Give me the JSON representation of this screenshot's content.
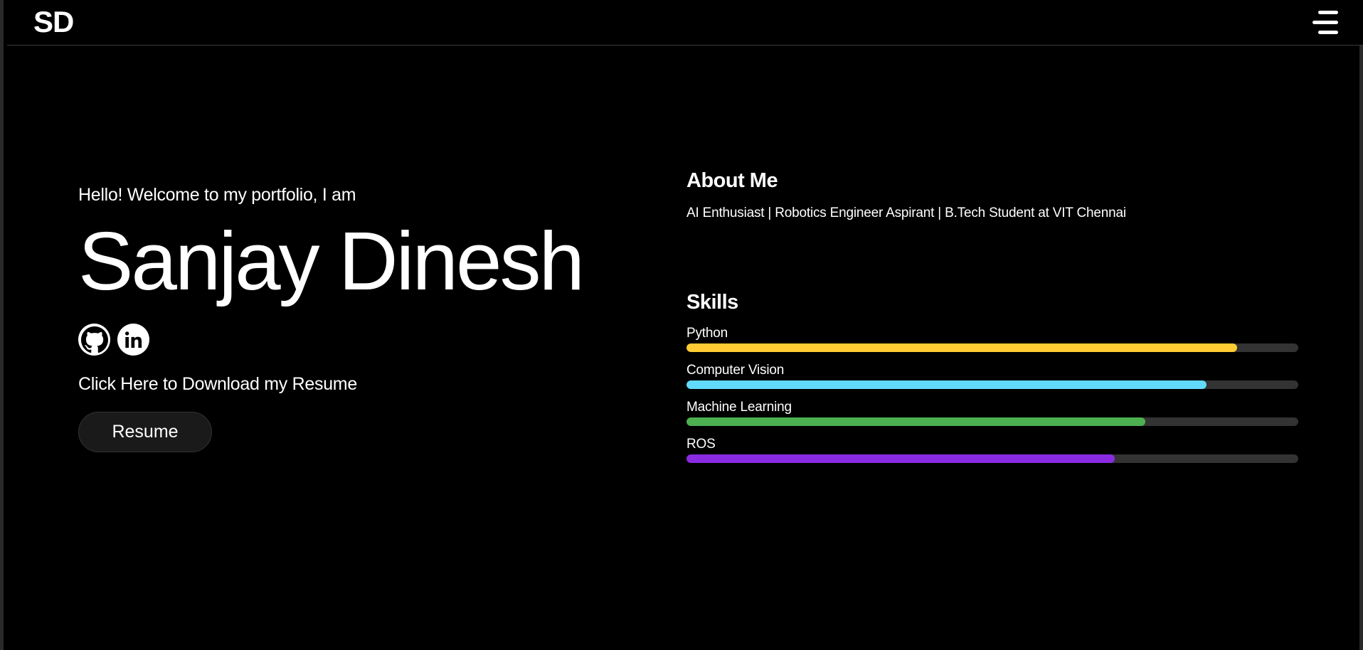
{
  "header": {
    "logo": "SD",
    "menu_icon": "hamburger-menu-icon"
  },
  "hero": {
    "greeting": "Hello! Welcome to my portfolio, I am",
    "name": "Sanjay Dinesh",
    "socials": [
      {
        "icon": "github-icon"
      },
      {
        "icon": "linkedin-icon"
      }
    ],
    "resume_prompt": "Click Here to Download my Resume",
    "resume_button": "Resume"
  },
  "about": {
    "title": "About Me",
    "text": "AI Enthusiast | Robotics Engineer Aspirant | B.Tech Student at VIT Chennai"
  },
  "skills": {
    "title": "Skills",
    "items": [
      {
        "label": "Python",
        "percent": 90,
        "color": "#ffcc33"
      },
      {
        "label": "Computer Vision",
        "percent": 85,
        "color": "#61dafb"
      },
      {
        "label": "Machine Learning",
        "percent": 75,
        "color": "#4caf50"
      },
      {
        "label": "ROS",
        "percent": 70,
        "color": "#8a2be2"
      }
    ],
    "track_color": "#333333"
  }
}
